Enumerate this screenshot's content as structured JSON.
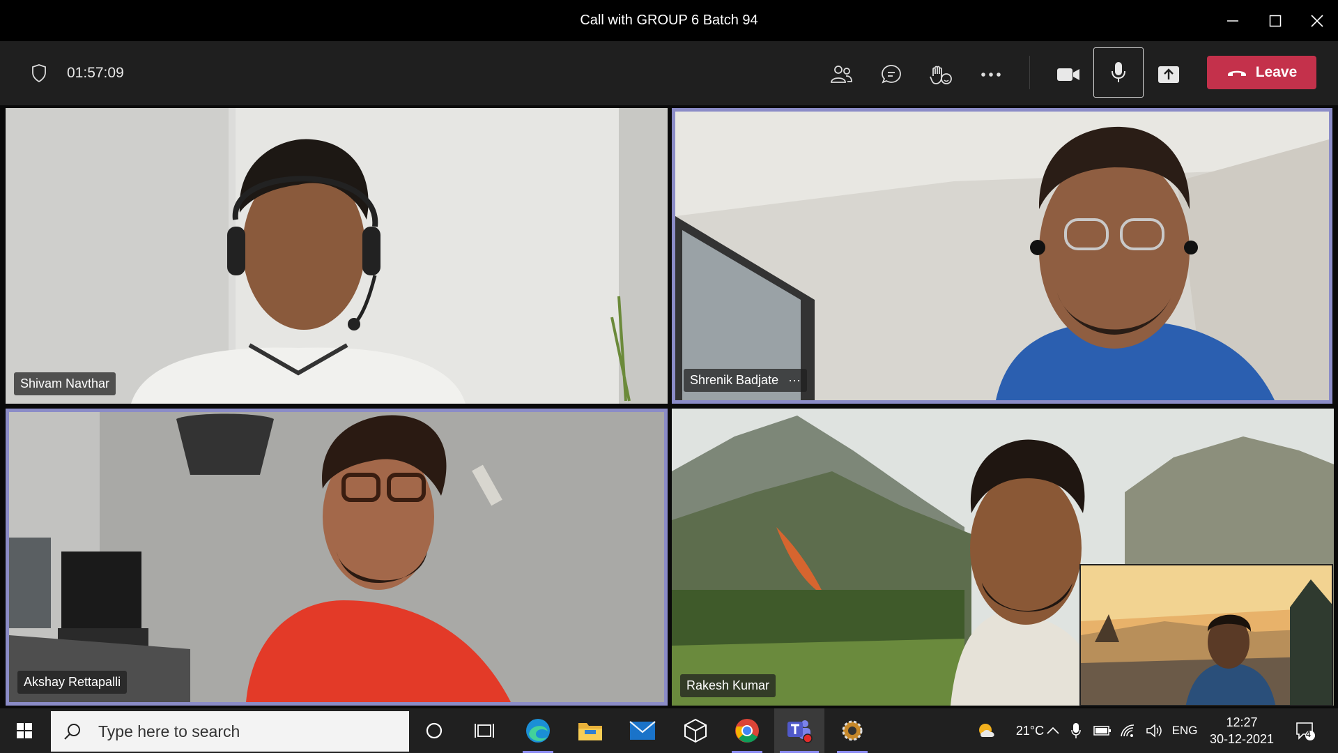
{
  "window": {
    "title": "Call with GROUP 6 Batch 94",
    "minimize_icon": "minimize-icon",
    "maximize_icon": "maximize-icon",
    "close_icon": "close-icon"
  },
  "toolbar": {
    "timer": "01:57:09",
    "icons": [
      "shield-icon",
      "participants-icon",
      "chat-icon",
      "reactions-icon",
      "more-icon",
      "camera-icon",
      "mic-icon",
      "share-icon"
    ],
    "leave_label": "Leave",
    "leave_color": "#c4314b"
  },
  "participants": [
    {
      "name": "Shivam Navthar"
    },
    {
      "name": "Shrenik Badjate",
      "more": "···"
    },
    {
      "name": "Akshay Rettapalli"
    },
    {
      "name": "Rakesh Kumar"
    }
  ],
  "accent_color": "#8b8cc7",
  "taskbar": {
    "search_placeholder": "Type here to search",
    "apps": [
      "windows-start-icon",
      "cortana-icon",
      "task-view-icon",
      "edge-icon",
      "file-explorer-icon",
      "mail-icon",
      "3d-app-icon",
      "chrome-icon",
      "teams-icon",
      "settings-app-icon"
    ],
    "weather": "21°C",
    "language": "ENG",
    "time": "12:27",
    "date": "30-12-2021",
    "notification_count": "4"
  }
}
